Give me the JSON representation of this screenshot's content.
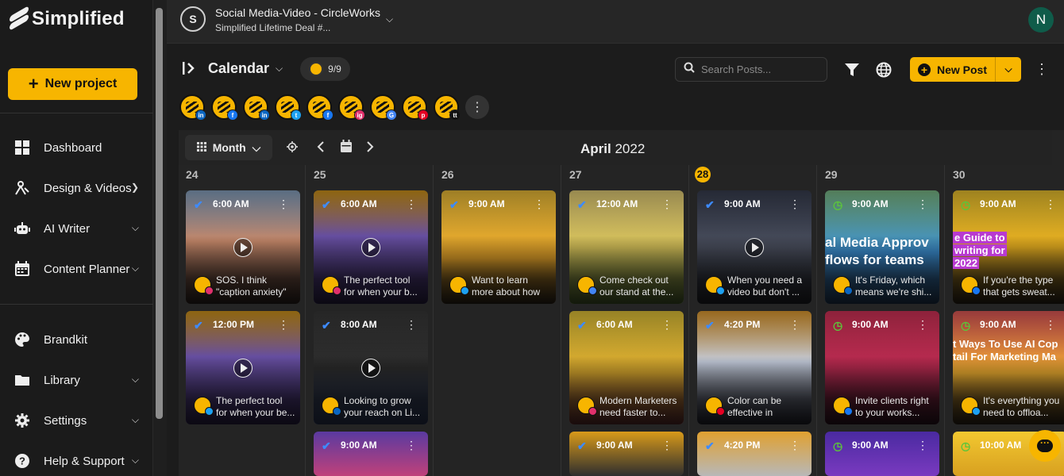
{
  "brand": {
    "name": "Simplified"
  },
  "sidebar": {
    "new_project_label": "New project",
    "items": [
      {
        "label": "Dashboard",
        "icon": "grid-icon"
      },
      {
        "label": "Design & Videos",
        "icon": "design-icon"
      },
      {
        "label": "AI Writer",
        "icon": "robot-icon"
      },
      {
        "label": "Content Planner",
        "icon": "calendar-icon"
      },
      {
        "label": "Brandkit",
        "icon": "palette-icon"
      },
      {
        "label": "Library",
        "icon": "folder-icon"
      },
      {
        "label": "Settings",
        "icon": "gear-icon"
      },
      {
        "label": "Help & Support",
        "icon": "help-icon"
      }
    ]
  },
  "topbar": {
    "avatar_letter": "S",
    "project_title": "Social Media-Video - CircleWorks",
    "project_sub": "Simplified Lifetime Deal #...",
    "user_initial": "N"
  },
  "calendar": {
    "title": "Calendar",
    "count": "9/9",
    "search_placeholder": "Search Posts...",
    "new_post_label": "New Post",
    "view_label": "Month",
    "month": "April",
    "year": "2022",
    "days": [
      "24",
      "25",
      "26",
      "27",
      "28",
      "29",
      "30"
    ],
    "today": "28"
  },
  "profiles": [
    {
      "badge": "in",
      "color": "#0a66c2"
    },
    {
      "badge": "f",
      "color": "#1877f2"
    },
    {
      "badge": "in",
      "color": "#0a66c2"
    },
    {
      "badge": "t",
      "color": "#1da1f2"
    },
    {
      "badge": "f",
      "color": "#1877f2"
    },
    {
      "badge": "ig",
      "color": "#e1306c"
    },
    {
      "badge": "G",
      "color": "#4285f4"
    },
    {
      "badge": "p",
      "color": "#e60023"
    },
    {
      "badge": "tt",
      "color": "#111111"
    }
  ],
  "posts": {
    "d24a": {
      "time": "6:00 AM",
      "text": "SOS. I think \"caption anxiety\" is a ..."
    },
    "d24b": {
      "time": "12:00 PM",
      "text": "The perfect tool for when your be..."
    },
    "d25a": {
      "time": "6:00 AM",
      "text": "The perfect tool for when your b..."
    },
    "d25b": {
      "time": "8:00 AM",
      "text": "Looking to grow your reach on Li..."
    },
    "d25c": {
      "time": "9:00 AM"
    },
    "d26a": {
      "time": "9:00 AM",
      "text": "Want to learn more about how to..."
    },
    "d27a": {
      "time": "12:00 AM",
      "text": "Come check out our stand at the..."
    },
    "d27b": {
      "time": "6:00 AM",
      "text": "Modern Marketers need faster to..."
    },
    "d27c": {
      "time": "9:00 AM"
    },
    "d28a": {
      "time": "9:00 AM",
      "text": "When you need a video but don't ..."
    },
    "d28b": {
      "time": "4:20 PM",
      "text": "Color can be effective in marketi..."
    },
    "d28c": {
      "time": "4:20 PM"
    },
    "d29a": {
      "time": "9:00 AM",
      "text": "It's Friday, which means we're shi...",
      "headline1": "al Media Approv",
      "headline2": "flows for teams"
    },
    "d29b": {
      "time": "9:00 AM",
      "text": "Invite clients right to your works..."
    },
    "d29c": {
      "time": "9:00 AM"
    },
    "d30a": {
      "time": "9:00 AM",
      "text": "If you're the type that gets sweat...",
      "headline1": "e Guide to",
      "headline2": "writing for",
      "headline3": "2022"
    },
    "d30b": {
      "time": "9:00 AM",
      "text": "It's everything you need to offloa...",
      "headline1": "t Ways To Use AI Cop",
      "headline2": "tail For Marketing Ma"
    },
    "d30c": {
      "time": "10:00 AM"
    }
  }
}
